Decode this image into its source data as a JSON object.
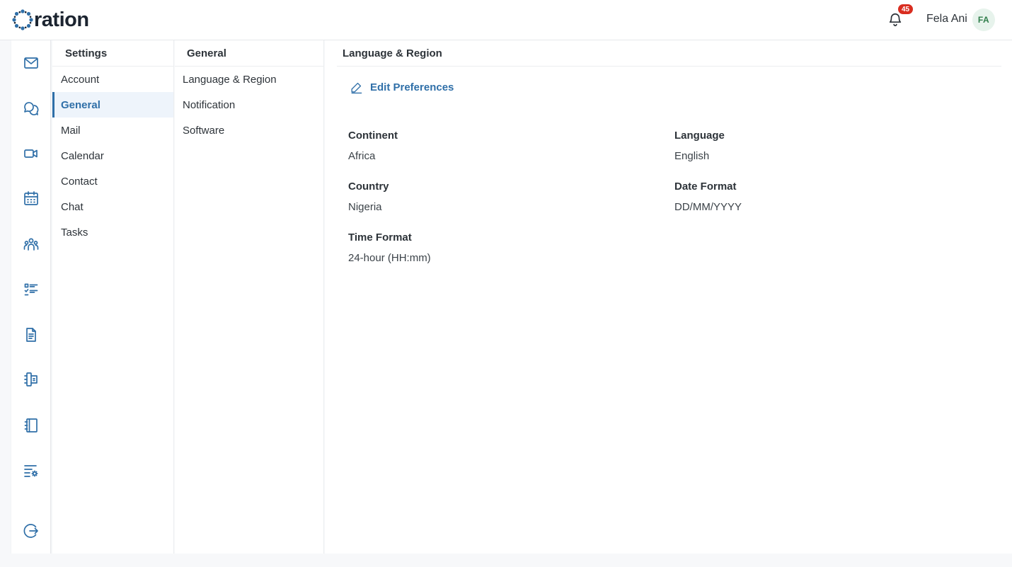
{
  "app": {
    "logo_text": "ration"
  },
  "header": {
    "notification_count": "45",
    "user_name": "Fela Ani",
    "user_initials": "FA"
  },
  "rail": {
    "icons": [
      "mail-icon",
      "chat-icon",
      "video-icon",
      "calendar-icon",
      "contacts-icon",
      "tasks-icon",
      "document-icon",
      "notebook-icon",
      "book-icon",
      "settings-list-icon",
      "logout-icon"
    ]
  },
  "settings_nav": {
    "title": "Settings",
    "items": [
      "Account",
      "General",
      "Mail",
      "Calendar",
      "Contact",
      "Chat",
      "Tasks"
    ],
    "active": "General"
  },
  "general_nav": {
    "title": "General",
    "items": [
      "Language & Region",
      "Notification",
      "Software"
    ]
  },
  "main": {
    "title": "Language & Region",
    "edit_label": "Edit Preferences",
    "fields": {
      "continent": {
        "label": "Continent",
        "value": "Africa"
      },
      "language": {
        "label": "Language",
        "value": "English"
      },
      "country": {
        "label": "Country",
        "value": "Nigeria"
      },
      "date_format": {
        "label": "Date Format",
        "value": "DD/MM/YYYY"
      },
      "time_format": {
        "label": "Time Format",
        "value": "24-hour (HH:mm)"
      }
    }
  },
  "colors": {
    "accent": "#2f6fa8",
    "badge": "#d92d20",
    "avatar_bg": "#e7f3ec"
  }
}
